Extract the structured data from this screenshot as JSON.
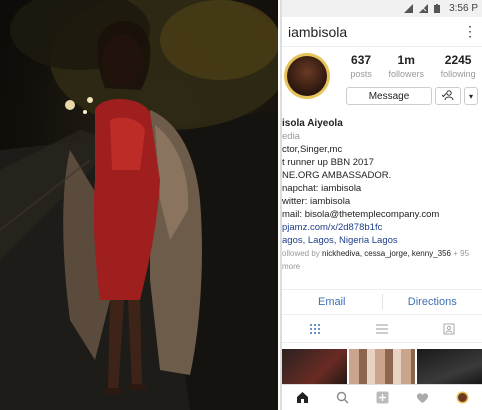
{
  "status_bar": {
    "time": "3:56 P",
    "icons": [
      "wifi-icon",
      "signal-icon",
      "battery-icon"
    ]
  },
  "header": {
    "username": "iambisola",
    "more_label": "⋮"
  },
  "stats": {
    "posts": {
      "value": "637",
      "label": "posts"
    },
    "followers": {
      "value": "1m",
      "label": "followers"
    },
    "following": {
      "value": "2245",
      "label": "following"
    }
  },
  "actions": {
    "message_label": "Message",
    "dropdown_label": "▾"
  },
  "bio": {
    "name": "isola Aiyeola",
    "category": "edia",
    "lines": [
      "ctor,Singer,mc",
      "t runner up BBN 2017",
      "NE.ORG AMBASSADOR.",
      "napchat: iambisola",
      "witter: iambisola",
      "mail: bisola@thetemplecompany.com"
    ],
    "link": "pjamz.com/x/2d878b1fc",
    "location": "agos, Lagos, Nigeria Lagos",
    "followed_prefix": "ollowed by ",
    "followed_names": "nickhediva, cessa_jorge, kenny_356",
    "followed_suffix": " + 95 more"
  },
  "contact": {
    "email_label": "Email",
    "directions_label": "Directions"
  },
  "colors": {
    "link_blue": "#3f6fb3",
    "avatar_ring": "#e7c35a"
  }
}
